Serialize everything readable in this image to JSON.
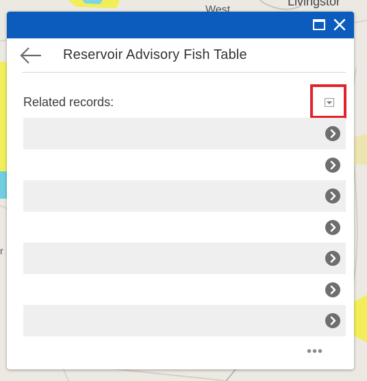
{
  "map": {
    "label_top": "Livingstor",
    "label_west": "West",
    "label_left": "r"
  },
  "popup": {
    "header": {
      "maximize_icon": "maximize-icon",
      "close_icon": "close-icon",
      "color": "#0b5cbd"
    },
    "back_icon": "arrow-left-icon",
    "title": "Reservoir Advisory Fish Table",
    "related_label": "Related records:",
    "dropdown_icon": "chevron-down-icon",
    "highlight_color": "#e0242b",
    "records": [
      {
        "shaded": true
      },
      {
        "shaded": false
      },
      {
        "shaded": true
      },
      {
        "shaded": false
      },
      {
        "shaded": true
      },
      {
        "shaded": false
      },
      {
        "shaded": true
      }
    ],
    "row_icon": "chevron-right-circle-icon",
    "more_label": "•••"
  }
}
